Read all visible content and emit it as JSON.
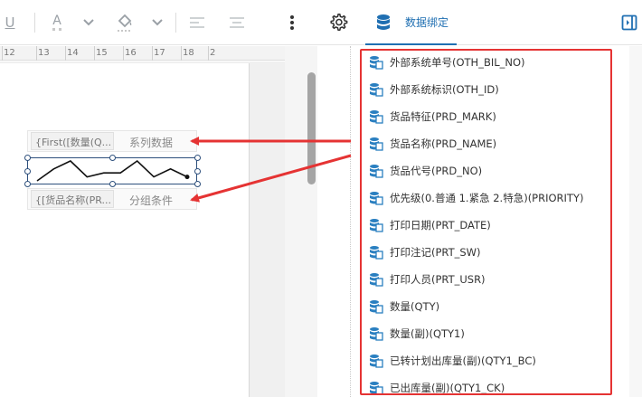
{
  "toolbar": {
    "underline_glyph": "U",
    "font_color_glyph": "A",
    "panel_tab_label": "数据绑定"
  },
  "ruler": {
    "ticks": [
      "12",
      "13",
      "14",
      "15",
      "16",
      "17",
      "18",
      "2"
    ]
  },
  "sparkline": {
    "series_field": "{First([数量(Q...",
    "series_caption": "系列数据",
    "group_field": "{[货品名称(PR...",
    "group_caption": "分组条件",
    "points": [
      3,
      6,
      8,
      4,
      5,
      5,
      8,
      4,
      6,
      4
    ]
  },
  "fields": [
    "外部系统单号(OTH_BIL_NO)",
    "外部系统标识(OTH_ID)",
    "货品特征(PRD_MARK)",
    "货品名称(PRD_NAME)",
    "货品代号(PRD_NO)",
    "优先级(0.普通 1.紧急 2.特急)(PRIORITY)",
    "打印日期(PRT_DATE)",
    "打印注记(PRT_SW)",
    "打印人员(PRT_USR)",
    "数量(QTY)",
    "数量(副)(QTY1)",
    "已转计划出库量(副)(QTY1_BC)",
    "已出库量(副)(QTY1_CK)"
  ],
  "colors": {
    "accent": "#1f6fb2",
    "highlight": "#e53333",
    "field_icon": "#2a7fc0"
  }
}
